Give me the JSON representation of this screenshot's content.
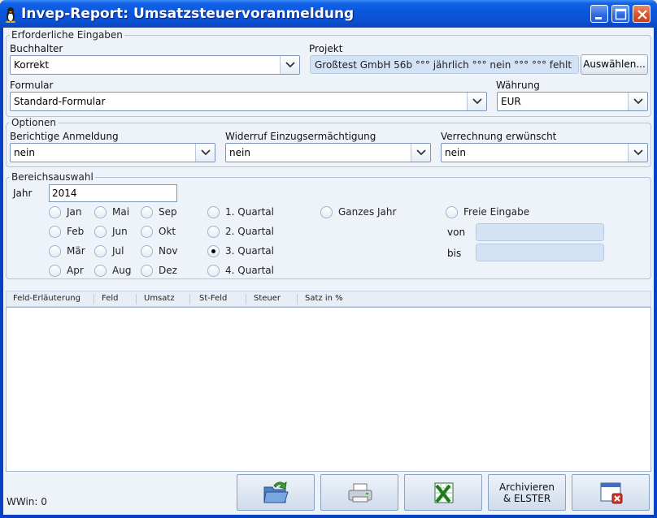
{
  "window": {
    "title": "Invep-Report: Umsatzsteuervoranmeldung"
  },
  "required": {
    "legend": "Erforderliche Eingaben",
    "buchhalter_label": "Buchhalter",
    "buchhalter_value": "Korrekt",
    "projekt_label": "Projekt",
    "projekt_value": "Großtest GmbH 56b °°° jährlich °°° nein °°° °°° fehlt",
    "select_button": "Auswählen...",
    "formular_label": "Formular",
    "formular_value": "Standard-Formular",
    "waehrung_label": "Währung",
    "waehrung_value": "EUR"
  },
  "options": {
    "legend": "Optionen",
    "berichtige_label": "Berichtige Anmeldung",
    "berichtige_value": "nein",
    "widerruf_label": "Widerruf Einzugsermächtigung",
    "widerruf_value": "nein",
    "verrechnung_label": "Verrechnung erwünscht",
    "verrechnung_value": "nein"
  },
  "range": {
    "legend": "Bereichsauswahl",
    "jahr_label": "Jahr",
    "jahr_value": "2014",
    "months": [
      "Jan",
      "Feb",
      "Mär",
      "Apr",
      "Mai",
      "Jun",
      "Jul",
      "Aug",
      "Sep",
      "Okt",
      "Nov",
      "Dez"
    ],
    "quarters": [
      "1. Quartal",
      "2. Quartal",
      "3. Quartal",
      "4. Quartal"
    ],
    "selected": "3. Quartal",
    "whole_year": "Ganzes Jahr",
    "free_entry": "Freie Eingabe",
    "von_label": "von",
    "bis_label": "bis"
  },
  "table": {
    "columns": [
      "Feld-Erläuterung",
      "Feld",
      "Umsatz",
      "St-Feld",
      "Steuer",
      "Satz in %"
    ]
  },
  "status": "WWin: 0",
  "buttons": {
    "archive_line1": "Archivieren",
    "archive_line2": "& ELSTER"
  },
  "icons": {
    "open": "folder-open-icon",
    "print": "printer-icon",
    "export": "excel-icon",
    "close": "close-window-icon"
  }
}
